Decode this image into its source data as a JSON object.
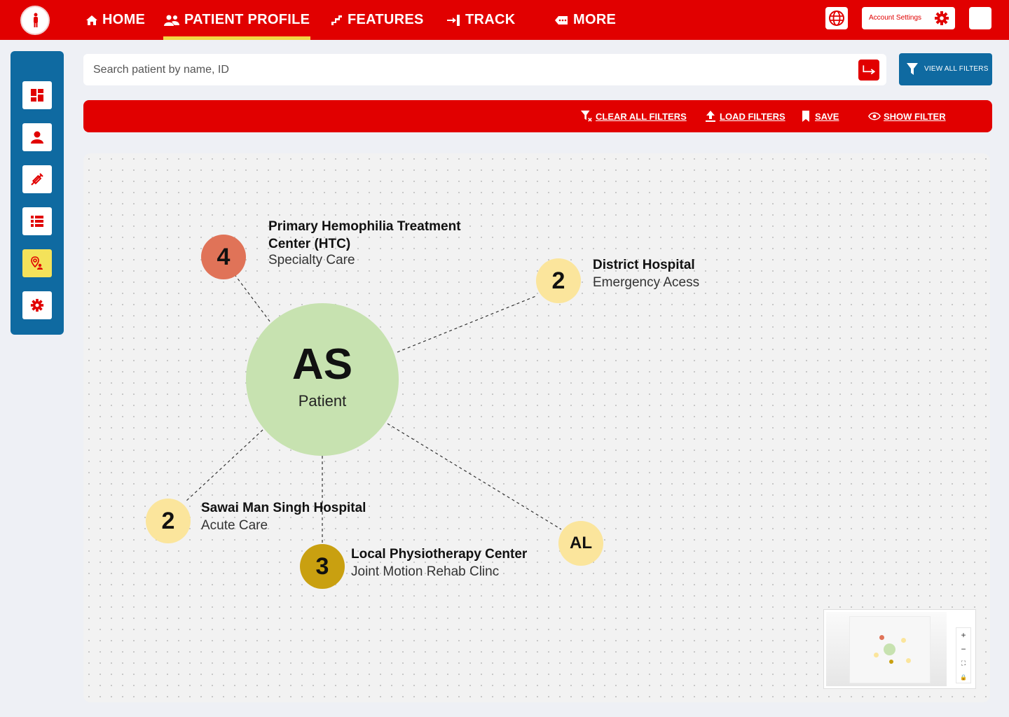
{
  "header": {
    "nav": [
      {
        "label": "HOME",
        "icon": "home-icon",
        "active": false
      },
      {
        "label": "PATIENT PROFILE",
        "icon": "users-icon",
        "active": true
      },
      {
        "label": "FEATURES",
        "icon": "stairs-icon",
        "active": false
      },
      {
        "label": "TRACK",
        "icon": "sign-in-icon",
        "active": false
      },
      {
        "label": "MORE",
        "icon": "tag-icon",
        "active": false
      }
    ],
    "account_settings_label": "Account Settings"
  },
  "search": {
    "placeholder": "Search patient by name, ID"
  },
  "view_all_filters_label": "VIEW ALL FILTERS",
  "filter_bar": {
    "clear": "CLEAR ALL FILTERS",
    "load": "LOAD FILTERS",
    "save": "SAVE",
    "show": "SHOW FILTER"
  },
  "graph": {
    "center": {
      "initials": "AS",
      "subtitle": "Patient"
    },
    "nodes": [
      {
        "badge": "4",
        "title": "Primary Hemophilia Treatment Center (HTC)",
        "subtitle": "Specialty Care",
        "color": "#e07358"
      },
      {
        "badge": "2",
        "title": "District Hospital",
        "subtitle": "Emergency Acess",
        "color": "#fbe59c"
      },
      {
        "badge": "2",
        "title": "Sawai Man Singh Hospital",
        "subtitle": "Acute Care",
        "color": "#fbe59c"
      },
      {
        "badge": "3",
        "title": "Local Physiotherapy Center",
        "subtitle": "Joint Motion Rehab Clinc",
        "color": "#c9a010"
      },
      {
        "badge": "AL",
        "title": "",
        "subtitle": "",
        "color": "#fbe59c"
      }
    ]
  },
  "minimap": {
    "zoom_in": "+",
    "zoom_out": "−",
    "fit": "⛶",
    "lock": "🔒"
  },
  "colors": {
    "brand_red": "#e10000",
    "brand_blue": "#0f6aa1",
    "active_yellow": "#f4e25a",
    "center_green": "#c7e2b0"
  }
}
